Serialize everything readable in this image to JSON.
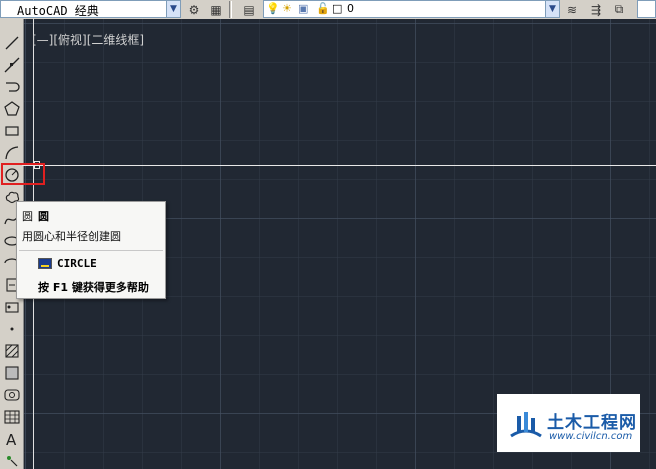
{
  "toolbar": {
    "workspace_value": "AutoCAD 经典",
    "layer_name": "0"
  },
  "viewport": {
    "label": "[—][俯视][二维线框]"
  },
  "tooltip": {
    "title": "圆",
    "description": "用圆心和半径创建圆",
    "command": "CIRCLE",
    "help": "按 F1 键获得更多帮助",
    "clipped_left_1": "圆",
    "clipped_left_2": "用",
    "clipped_left_3": "按"
  },
  "left_tools": [
    "line-icon",
    "construction-line-icon",
    "polyline-icon",
    "polygon-icon",
    "rectangle-icon",
    "arc-icon",
    "circle-icon",
    "revcloud-icon",
    "spline-icon",
    "ellipse-icon",
    "ellipse-arc-icon",
    "insert-block-icon",
    "make-block-icon",
    "point-icon",
    "hatch-icon",
    "gradient-icon",
    "region-icon",
    "table-icon",
    "mtext-icon",
    "add-selected-icon"
  ],
  "watermark": {
    "cn": "土木工程网",
    "url": "www.civilcn.com"
  },
  "colors": {
    "canvas": "#212833",
    "highlight": "#e02020",
    "brand": "#1a5ba8"
  }
}
